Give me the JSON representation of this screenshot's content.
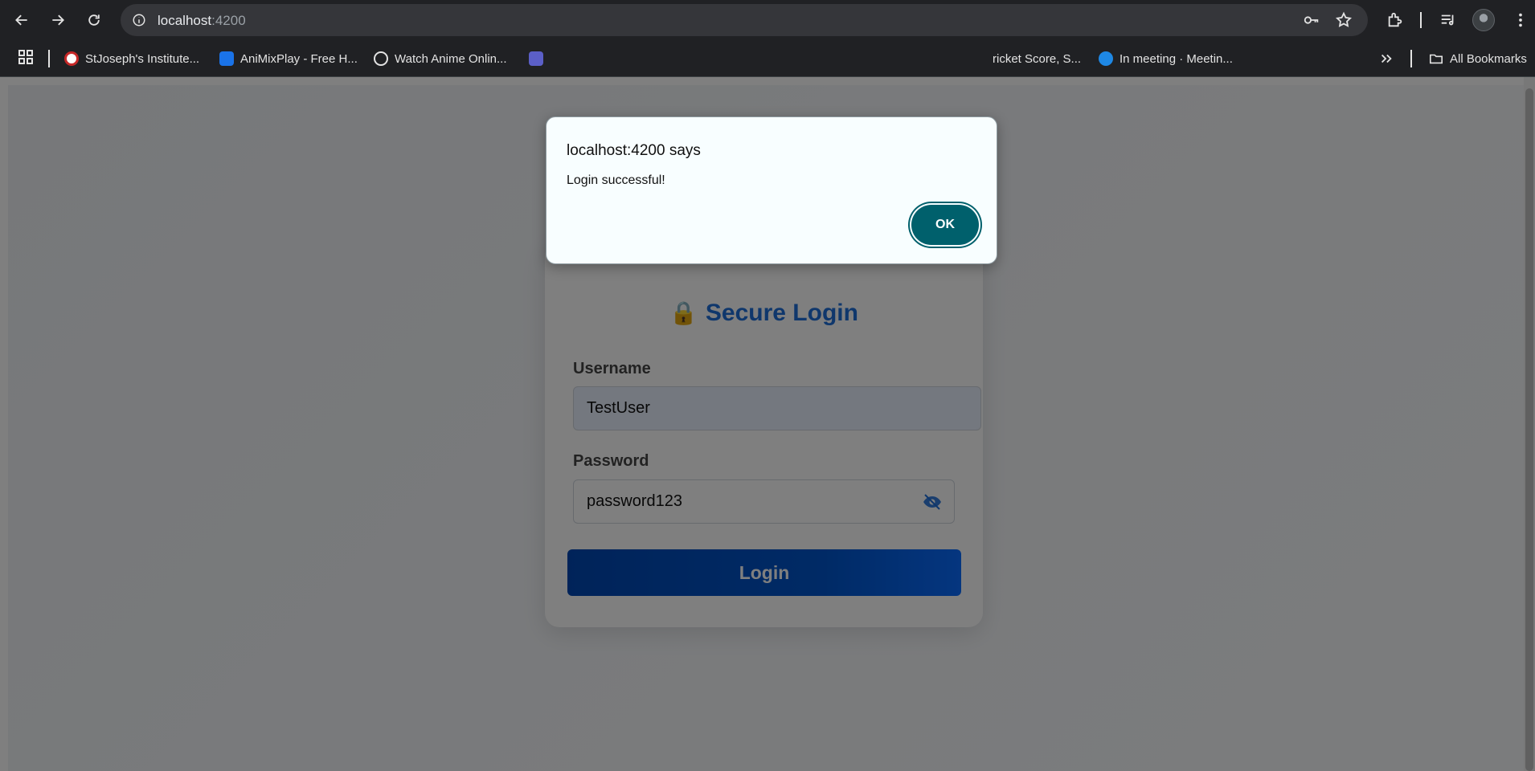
{
  "browser": {
    "url_host": "localhost",
    "url_port": ":4200",
    "bookmarks": [
      {
        "label": "StJoseph's Institute...",
        "color": "#c62828"
      },
      {
        "label": "AniMixPlay - Free H...",
        "color": "#1a73e8"
      },
      {
        "label": "Watch Anime Onlin...",
        "color": "#e3e3e3"
      },
      {
        "label": "ricket Score, S...",
        "color": "#4caf50"
      },
      {
        "label": "In meeting · Meetin...",
        "color": "#1e88e5"
      }
    ],
    "all_bookmarks": "All Bookmarks"
  },
  "login": {
    "title": "Secure Login",
    "lock_glyph": "🔒",
    "username_label": "Username",
    "username_value": "TestUser",
    "password_label": "Password",
    "password_value": "password123",
    "login_button": "Login",
    "accent_color": "#1e6fd9"
  },
  "dialog": {
    "title": "localhost:4200 says",
    "message": "Login successful!",
    "ok_button": "OK",
    "ok_color": "#00606c"
  }
}
